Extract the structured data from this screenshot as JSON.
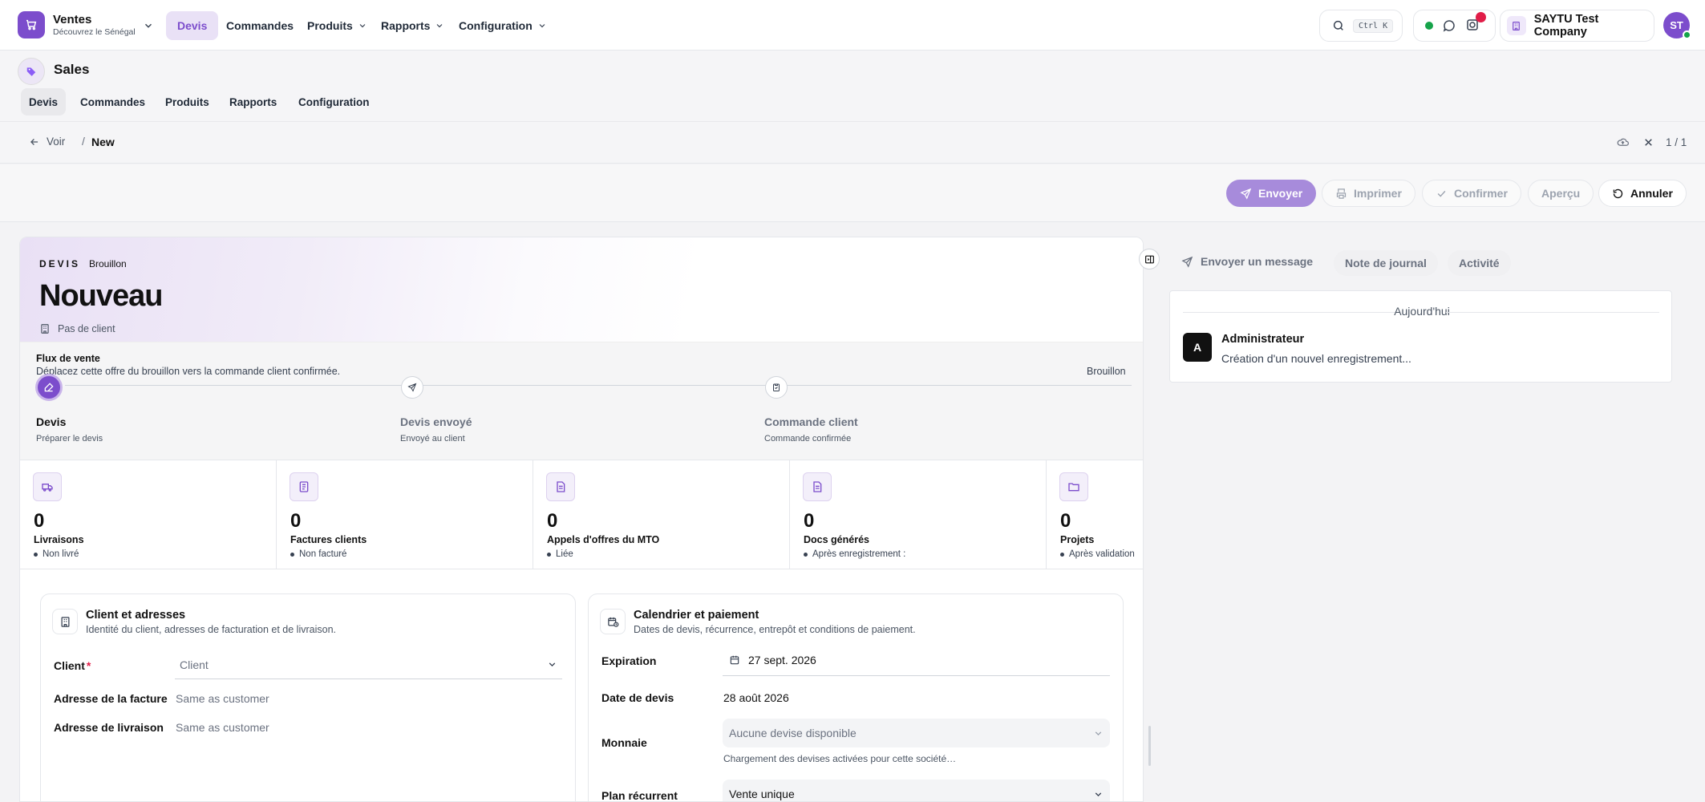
{
  "app": {
    "name": "Ventes",
    "subtitle": "Découvrez le Sénégal"
  },
  "topnav": {
    "items": [
      "Devis",
      "Commandes",
      "Produits",
      "Rapports",
      "Configuration"
    ],
    "active": "Devis"
  },
  "search": {
    "shortcut": "Ctrl K"
  },
  "notifications": {
    "badge_color": "#e11d48"
  },
  "company": {
    "name": "SAYTU Test Company"
  },
  "user": {
    "initials": "ST"
  },
  "module": {
    "title": "Sales",
    "tabs": [
      "Devis",
      "Commandes",
      "Produits",
      "Rapports",
      "Configuration"
    ],
    "active": "Devis"
  },
  "breadcrumb": {
    "back": "Voir",
    "separator": "/",
    "current": "New",
    "pager": "1 / 1"
  },
  "actions": {
    "send": "Envoyer",
    "print": "Imprimer",
    "confirm": "Confirmer",
    "preview": "Aperçu",
    "cancel": "Annuler"
  },
  "record": {
    "kind": "DEVIS",
    "state": "Brouillon",
    "title": "Nouveau",
    "client": "Pas de client"
  },
  "flow": {
    "title": "Flux de vente",
    "description": "Déplacez cette offre du brouillon vers la commande client confirmée.",
    "state": "Brouillon",
    "steps": [
      {
        "label": "Devis",
        "sub": "Préparer le devis"
      },
      {
        "label": "Devis envoyé",
        "sub": "Envoyé au client"
      },
      {
        "label": "Commande client",
        "sub": "Commande confirmée"
      }
    ]
  },
  "stats": [
    {
      "value": "0",
      "label": "Livraisons",
      "sub": "Non livré",
      "icon": "truck-icon"
    },
    {
      "value": "0",
      "label": "Factures clients",
      "sub": "Non facturé",
      "icon": "invoice-icon"
    },
    {
      "value": "0",
      "label": "Appels d'offres du MTO",
      "sub": "Liée",
      "icon": "document-icon"
    },
    {
      "value": "0",
      "label": "Docs générés",
      "sub": "Après enregistrement :",
      "icon": "document-icon"
    },
    {
      "value": "0",
      "label": "Projets",
      "sub": "Après validation",
      "icon": "folder-icon"
    }
  ],
  "client_section": {
    "title": "Client et adresses",
    "subtitle": "Identité du client, adresses de facturation et de livraison.",
    "client_label": "Client",
    "required_mark": "*",
    "client_placeholder": "Client",
    "invoice_label": "Adresse de la facture",
    "invoice_value": "Same as customer",
    "delivery_label": "Adresse de livraison",
    "delivery_value": "Same as customer"
  },
  "schedule_section": {
    "title": "Calendrier et paiement",
    "subtitle": "Dates de devis, récurrence, entrepôt et conditions de paiement.",
    "expiration_label": "Expiration",
    "expiration_value": "27 sept. 2026",
    "date_label": "Date de devis",
    "date_value": "28 août 2026",
    "currency_label": "Monnaie",
    "currency_value": "Aucune devise disponible",
    "currency_help": "Chargement des devises activées pour cette société…",
    "plan_label": "Plan récurrent",
    "plan_value": "Vente unique"
  },
  "chatter": {
    "tabs": [
      "Envoyer un message",
      "Note de journal",
      "Activité"
    ],
    "day": "Aujourd'hui",
    "author": "Administrateur",
    "avatar": "A",
    "message": "Création d'un nouvel enregistrement..."
  },
  "colors": {
    "accent": "#7c4dcc",
    "accent_light": "#a78bdb",
    "active_tab": "#e9e1f6"
  }
}
